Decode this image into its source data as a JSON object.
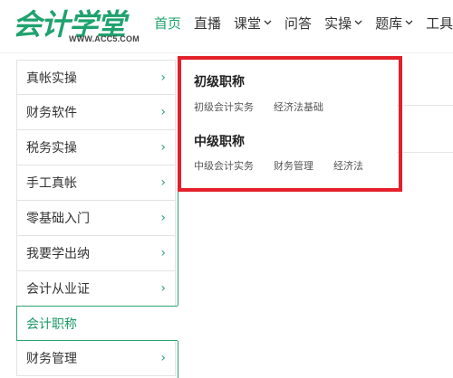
{
  "header": {
    "logo_text": "会计学堂",
    "logo_url": "WWW.ACC5.COM",
    "nav": [
      {
        "label": "首页",
        "active": true,
        "dropdown": false
      },
      {
        "label": "直播",
        "active": false,
        "dropdown": false
      },
      {
        "label": "课堂",
        "active": false,
        "dropdown": true
      },
      {
        "label": "问答",
        "active": false,
        "dropdown": false
      },
      {
        "label": "实操",
        "active": false,
        "dropdown": true
      },
      {
        "label": "题库",
        "active": false,
        "dropdown": true
      },
      {
        "label": "工具",
        "active": false,
        "dropdown": false
      }
    ]
  },
  "sidebar": {
    "items": [
      {
        "label": "真帐实操",
        "arrow": "›"
      },
      {
        "label": "财务软件",
        "arrow": "›"
      },
      {
        "label": "税务实操",
        "arrow": "›"
      },
      {
        "label": "手工真帐",
        "arrow": "›"
      },
      {
        "label": "零基础入门",
        "arrow": "›"
      },
      {
        "label": "我要学出纳",
        "arrow": "›"
      },
      {
        "label": "会计从业证",
        "arrow": "›"
      },
      {
        "label": "会计职称",
        "arrow": ""
      },
      {
        "label": "财务管理",
        "arrow": "›"
      }
    ],
    "active_index": 7
  },
  "panel": {
    "groups": [
      {
        "title": "初级职称",
        "links": [
          "初级会计实务",
          "经济法基础"
        ]
      },
      {
        "title": "中级职称",
        "links": [
          "中级会计实务",
          "财务管理",
          "经济法"
        ]
      }
    ]
  },
  "colors": {
    "brand_green": "#1fa26e",
    "highlight_red": "#e3202a"
  }
}
